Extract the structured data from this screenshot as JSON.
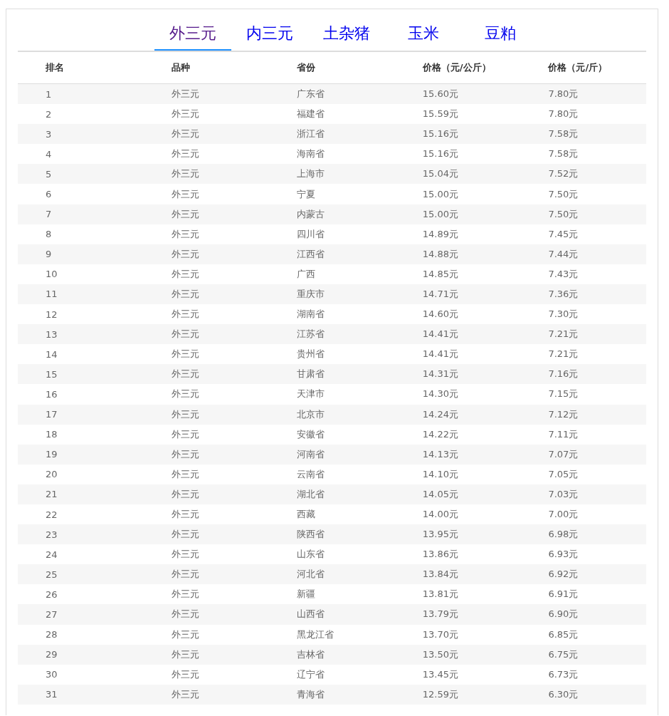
{
  "tabs": [
    {
      "label": "外三元",
      "selected": true
    },
    {
      "label": "内三元",
      "selected": false
    },
    {
      "label": "土杂猪",
      "selected": false
    },
    {
      "label": "玉米",
      "selected": false
    },
    {
      "label": "豆粕",
      "selected": false
    }
  ],
  "table": {
    "columns": [
      "排名",
      "品种",
      "省份",
      "价格（元/公斤）",
      "价格（元/斤）"
    ],
    "rows": [
      [
        "1",
        "外三元",
        "广东省",
        "15.60元",
        "7.80元"
      ],
      [
        "2",
        "外三元",
        "福建省",
        "15.59元",
        "7.80元"
      ],
      [
        "3",
        "外三元",
        "浙江省",
        "15.16元",
        "7.58元"
      ],
      [
        "4",
        "外三元",
        "海南省",
        "15.16元",
        "7.58元"
      ],
      [
        "5",
        "外三元",
        "上海市",
        "15.04元",
        "7.52元"
      ],
      [
        "6",
        "外三元",
        "宁夏",
        "15.00元",
        "7.50元"
      ],
      [
        "7",
        "外三元",
        "内蒙古",
        "15.00元",
        "7.50元"
      ],
      [
        "8",
        "外三元",
        "四川省",
        "14.89元",
        "7.45元"
      ],
      [
        "9",
        "外三元",
        "江西省",
        "14.88元",
        "7.44元"
      ],
      [
        "10",
        "外三元",
        "广西",
        "14.85元",
        "7.43元"
      ],
      [
        "11",
        "外三元",
        "重庆市",
        "14.71元",
        "7.36元"
      ],
      [
        "12",
        "外三元",
        "湖南省",
        "14.60元",
        "7.30元"
      ],
      [
        "13",
        "外三元",
        "江苏省",
        "14.41元",
        "7.21元"
      ],
      [
        "14",
        "外三元",
        "贵州省",
        "14.41元",
        "7.21元"
      ],
      [
        "15",
        "外三元",
        "甘肃省",
        "14.31元",
        "7.16元"
      ],
      [
        "16",
        "外三元",
        "天津市",
        "14.30元",
        "7.15元"
      ],
      [
        "17",
        "外三元",
        "北京市",
        "14.24元",
        "7.12元"
      ],
      [
        "18",
        "外三元",
        "安徽省",
        "14.22元",
        "7.11元"
      ],
      [
        "19",
        "外三元",
        "河南省",
        "14.13元",
        "7.07元"
      ],
      [
        "20",
        "外三元",
        "云南省",
        "14.10元",
        "7.05元"
      ],
      [
        "21",
        "外三元",
        "湖北省",
        "14.05元",
        "7.03元"
      ],
      [
        "22",
        "外三元",
        "西藏",
        "14.00元",
        "7.00元"
      ],
      [
        "23",
        "外三元",
        "陕西省",
        "13.95元",
        "6.98元"
      ],
      [
        "24",
        "外三元",
        "山东省",
        "13.86元",
        "6.93元"
      ],
      [
        "25",
        "外三元",
        "河北省",
        "13.84元",
        "6.92元"
      ],
      [
        "26",
        "外三元",
        "新疆",
        "13.81元",
        "6.91元"
      ],
      [
        "27",
        "外三元",
        "山西省",
        "13.79元",
        "6.90元"
      ],
      [
        "28",
        "外三元",
        "黑龙江省",
        "13.70元",
        "6.85元"
      ],
      [
        "29",
        "外三元",
        "吉林省",
        "13.50元",
        "6.75元"
      ],
      [
        "30",
        "外三元",
        "辽宁省",
        "13.45元",
        "6.73元"
      ],
      [
        "31",
        "外三元",
        "青海省",
        "12.59元",
        "6.30元"
      ]
    ]
  }
}
